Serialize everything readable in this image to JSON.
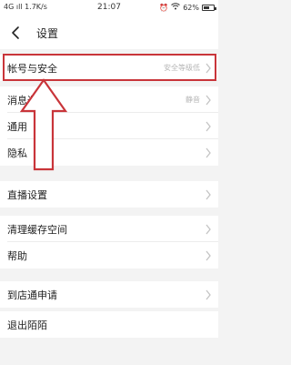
{
  "status_bar": {
    "network": "4G",
    "signal_text": "ıll",
    "speed": "1.7K/s",
    "time": "21:07",
    "battery_percent_text": "62%",
    "battery_level": 0.62
  },
  "header": {
    "title": "设置"
  },
  "settings": {
    "account_security": {
      "label": "帐号与安全",
      "value": "安全等级低"
    },
    "notifications": {
      "label": "消息通知",
      "value": "静音"
    },
    "general": {
      "label": "通用"
    },
    "privacy": {
      "label": "隐私"
    },
    "live_settings": {
      "label": "直播设置"
    },
    "clear_cache": {
      "label": "清理缓存空间"
    },
    "help": {
      "label": "帮助"
    },
    "store_apply": {
      "label": "到店通申请"
    },
    "logout": {
      "label": "退出陌陌"
    }
  },
  "colors": {
    "annotation_red": "#c9353a",
    "background": "#f3f3f3",
    "chevron": "#c4c4c4"
  }
}
